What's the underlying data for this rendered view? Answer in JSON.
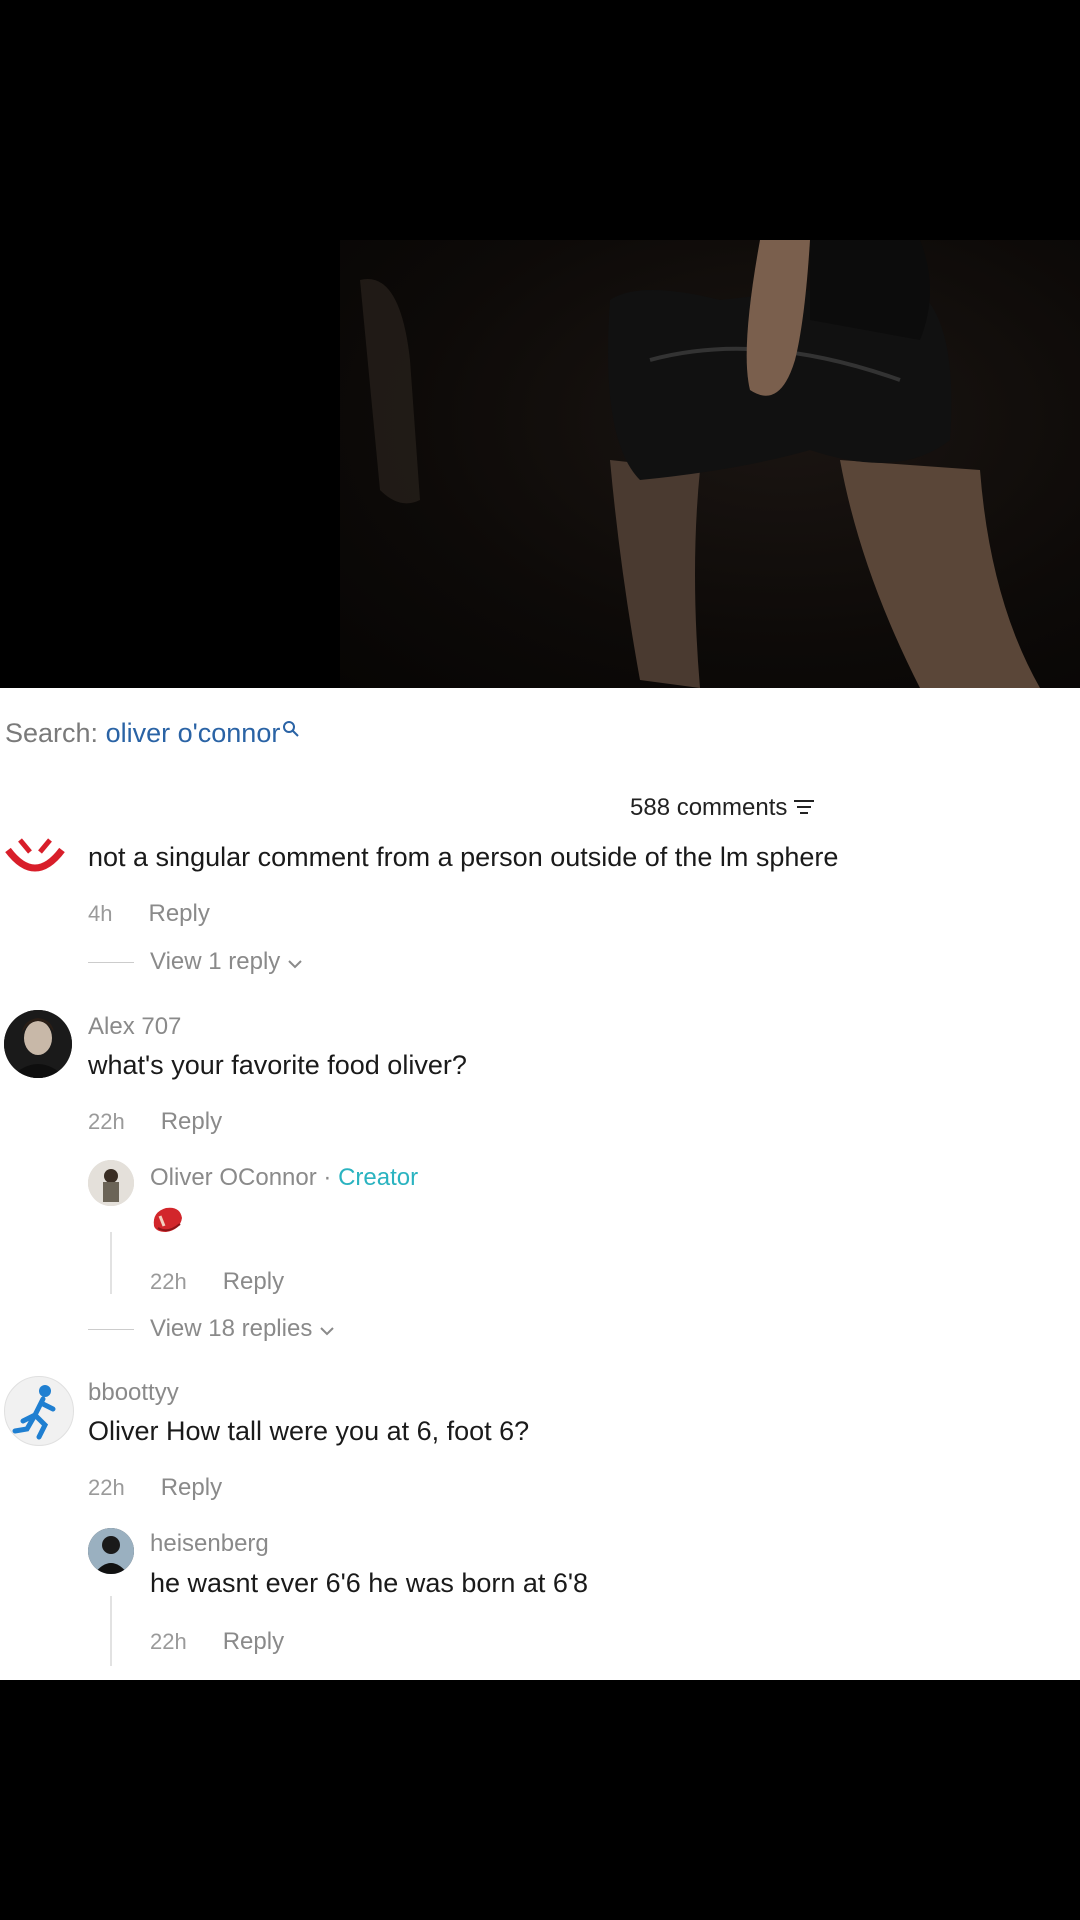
{
  "search": {
    "label": "Search:",
    "query": "oliver o'connor"
  },
  "comments_header": {
    "count_text": "588 comments"
  },
  "comments": [
    {
      "text": "not a singular comment from a person outside of the lm sphere",
      "time": "4h",
      "reply_label": "Reply",
      "view_replies": "View 1 reply"
    },
    {
      "username": "Alex 707",
      "text": "what's your favorite food oliver?",
      "time": "22h",
      "reply_label": "Reply",
      "view_replies": "View 18 replies",
      "reply": {
        "username": "Oliver OConnor",
        "badge_sep": " · ",
        "badge": "Creator",
        "time": "22h",
        "reply_label": "Reply"
      }
    },
    {
      "username": "bboottyy",
      "text": "Oliver How tall were you at 6, foot 6?",
      "time": "22h",
      "reply_label": "Reply",
      "reply": {
        "username": "heisenberg",
        "text": "he wasnt ever 6'6 he was born at 6'8",
        "time": "22h",
        "reply_label": "Reply"
      }
    }
  ],
  "colors": {
    "accent_link": "#2a63a5",
    "creator_badge": "#2ab3c0"
  }
}
